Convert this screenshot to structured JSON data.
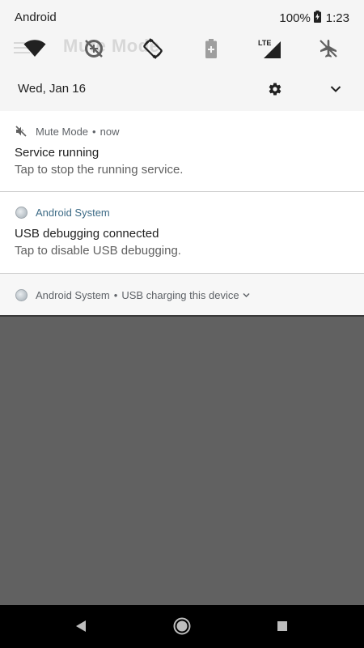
{
  "status_bar": {
    "carrier": "Android",
    "battery_percent": "100%",
    "time": "1:23"
  },
  "background_app": {
    "title": "Mute Mode"
  },
  "quick_settings": {
    "tiles": [
      {
        "icon": "wifi-icon",
        "state": "on"
      },
      {
        "icon": "data-saver-icon",
        "state": "off"
      },
      {
        "icon": "auto-rotate-icon",
        "state": "on"
      },
      {
        "icon": "battery-saver-icon",
        "state": "off"
      },
      {
        "icon": "mobile-data-lte-icon",
        "state": "on",
        "label": "LTE"
      },
      {
        "icon": "airplane-mode-icon",
        "state": "off"
      }
    ],
    "date": "Wed, Jan 16"
  },
  "notifications": [
    {
      "app": "Mute Mode",
      "time": "now",
      "icon": "volume-off-icon",
      "title": "Service running",
      "text": "Tap to stop the running service."
    },
    {
      "app": "Android System",
      "icon": "android-system-icon",
      "title": "USB debugging connected",
      "text": "Tap to disable USB debugging."
    },
    {
      "app": "Android System",
      "icon": "android-system-icon",
      "summary": "USB charging this device"
    }
  ],
  "colors": {
    "shade_bg": "#f5f5f5",
    "scrim": "#616161",
    "nav_bar": "#000000",
    "accent_app_name": "#3d6b86"
  }
}
